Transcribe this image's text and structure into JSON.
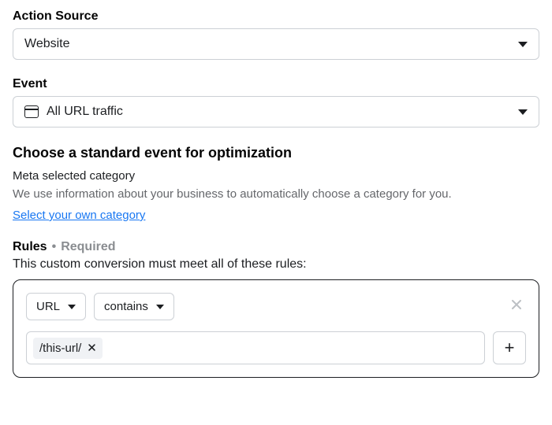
{
  "action_source": {
    "label": "Action Source",
    "value": "Website"
  },
  "event": {
    "label": "Event",
    "value": "All URL traffic"
  },
  "optimization": {
    "heading": "Choose a standard event for optimization",
    "subheading": "Meta selected category",
    "description": "We use information about your business to automatically choose a category for you.",
    "link": "Select your own category"
  },
  "rules": {
    "title": "Rules",
    "required_label": "Required",
    "description": "This custom conversion must meet all of these rules:",
    "field_select": "URL",
    "operator_select": "contains",
    "chip_value": "/this-url/",
    "add_label": "+"
  }
}
